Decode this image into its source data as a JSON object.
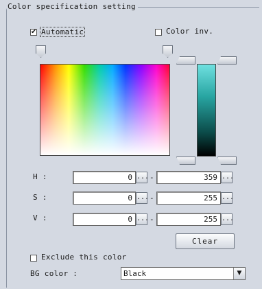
{
  "panel": {
    "title": "Color specification setting"
  },
  "options": {
    "automatic": {
      "label": "Automatic",
      "checked": true,
      "mark": "✔"
    },
    "color_inv": {
      "label": "Color inv.",
      "checked": false,
      "mark": ""
    },
    "exclude": {
      "label": "Exclude this color",
      "checked": false,
      "mark": ""
    }
  },
  "rows": [
    {
      "label": "H :",
      "min": "0",
      "max": "359"
    },
    {
      "label": "S :",
      "min": "0",
      "max": "255"
    },
    {
      "label": "V :",
      "min": "0",
      "max": "255"
    }
  ],
  "ellipsis": "...",
  "separator": "-",
  "clear_label": "Clear",
  "bg_color": {
    "label": "BG color :",
    "value": "Black",
    "arrow": "▼"
  }
}
